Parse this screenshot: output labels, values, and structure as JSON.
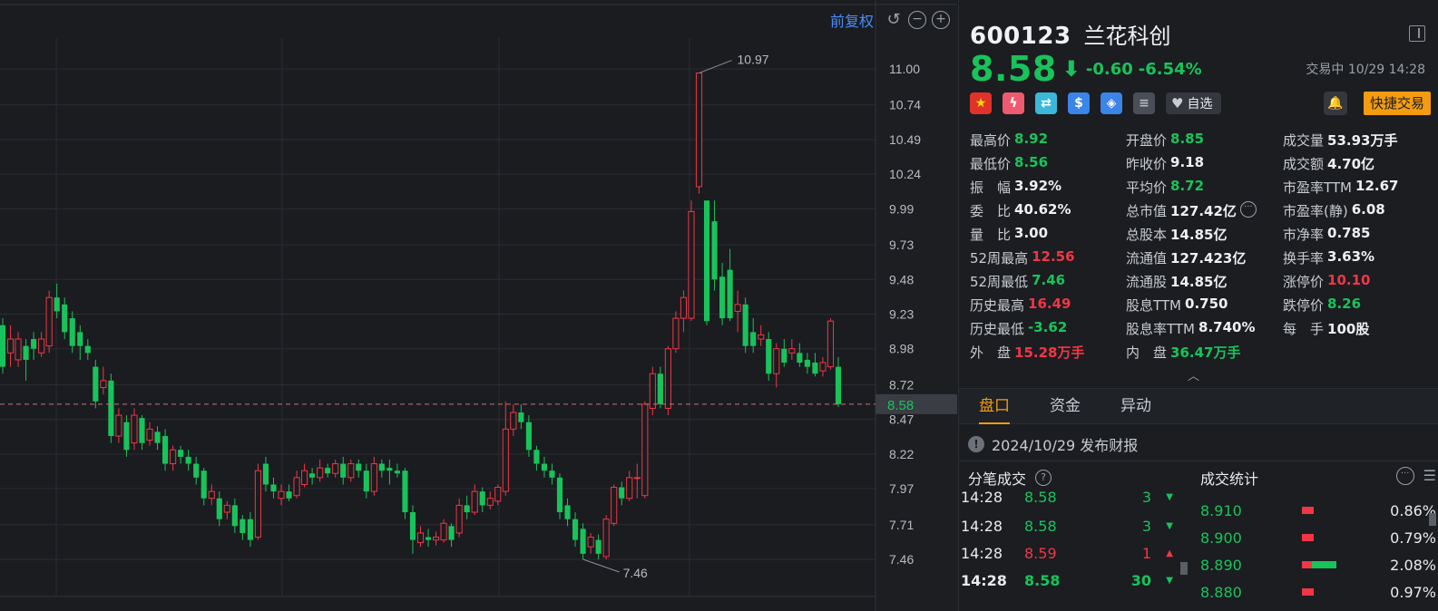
{
  "toolbar": {
    "restore_label": "前复权"
  },
  "chart_data": {
    "type": "candlestick",
    "y_ticks": [
      "11.00",
      "10.74",
      "10.49",
      "10.24",
      "9.99",
      "9.73",
      "9.48",
      "9.23",
      "8.98",
      "8.72",
      "8.47",
      "8.22",
      "7.97",
      "7.71",
      "7.46"
    ],
    "ylim": [
      7.35,
      11.12
    ],
    "current_price_label": "8.58",
    "current_price": 8.58,
    "high_annotation": "10.97",
    "low_annotation": "7.46",
    "colors": {
      "up": "#f23645",
      "down": "#19c35b",
      "grid": "#2a2d33"
    },
    "candles": [
      [
        9.15,
        8.85,
        9.2,
        8.8
      ],
      [
        8.95,
        9.05,
        9.15,
        8.85
      ],
      [
        8.9,
        9.05,
        9.1,
        8.85
      ],
      [
        9.0,
        8.9,
        9.05,
        8.75
      ],
      [
        9.05,
        8.98,
        9.1,
        8.9
      ],
      [
        8.95,
        9.05,
        9.1,
        8.92
      ],
      [
        9.0,
        9.35,
        9.4,
        8.95
      ],
      [
        9.35,
        9.25,
        9.45,
        9.2
      ],
      [
        9.3,
        9.1,
        9.35,
        9.05
      ],
      [
        9.2,
        9.0,
        9.25,
        8.95
      ],
      [
        9.1,
        9.0,
        9.15,
        8.9
      ],
      [
        9.0,
        8.95,
        9.05,
        8.9
      ],
      [
        8.85,
        8.6,
        8.9,
        8.55
      ],
      [
        8.7,
        8.75,
        8.85,
        8.65
      ],
      [
        8.75,
        8.35,
        8.8,
        8.3
      ],
      [
        8.35,
        8.5,
        8.55,
        8.3
      ],
      [
        8.45,
        8.25,
        8.5,
        8.2
      ],
      [
        8.3,
        8.5,
        8.55,
        8.25
      ],
      [
        8.48,
        8.3,
        8.5,
        8.25
      ],
      [
        8.32,
        8.4,
        8.45,
        8.28
      ],
      [
        8.38,
        8.3,
        8.42,
        8.25
      ],
      [
        8.35,
        8.15,
        8.4,
        8.1
      ],
      [
        8.15,
        8.25,
        8.28,
        8.1
      ],
      [
        8.25,
        8.2,
        8.28,
        8.15
      ],
      [
        8.2,
        8.15,
        8.25,
        8.1
      ],
      [
        8.15,
        8.05,
        8.2,
        8.0
      ],
      [
        8.1,
        7.9,
        8.12,
        7.85
      ],
      [
        7.9,
        7.95,
        8.0,
        7.85
      ],
      [
        7.9,
        7.75,
        7.95,
        7.7
      ],
      [
        7.8,
        7.85,
        7.88,
        7.75
      ],
      [
        7.85,
        7.7,
        7.9,
        7.65
      ],
      [
        7.75,
        7.65,
        7.78,
        7.6
      ],
      [
        7.75,
        7.6,
        7.8,
        7.55
      ],
      [
        7.62,
        8.1,
        8.15,
        7.6
      ],
      [
        8.15,
        8.0,
        8.2,
        7.95
      ],
      [
        8.0,
        7.95,
        8.05,
        7.9
      ],
      [
        7.9,
        7.95,
        8.0,
        7.85
      ],
      [
        7.95,
        7.9,
        8.0,
        7.88
      ],
      [
        7.92,
        8.05,
        8.1,
        7.9
      ],
      [
        8.0,
        8.1,
        8.15,
        7.98
      ],
      [
        8.08,
        8.05,
        8.12,
        8.0
      ],
      [
        8.05,
        8.12,
        8.18,
        8.02
      ],
      [
        8.12,
        8.08,
        8.15,
        8.05
      ],
      [
        8.08,
        8.15,
        8.18,
        8.05
      ],
      [
        8.15,
        8.05,
        8.2,
        8.0
      ],
      [
        8.05,
        8.15,
        8.18,
        8.02
      ],
      [
        8.15,
        8.1,
        8.18,
        8.05
      ],
      [
        8.1,
        7.95,
        8.15,
        7.9
      ],
      [
        7.95,
        8.15,
        8.2,
        7.92
      ],
      [
        8.15,
        8.1,
        8.18,
        8.05
      ],
      [
        8.12,
        8.1,
        8.18,
        8.0
      ],
      [
        8.1,
        8.08,
        8.15,
        8.05
      ],
      [
        8.1,
        7.8,
        8.12,
        7.75
      ],
      [
        7.8,
        7.6,
        7.85,
        7.5
      ],
      [
        7.58,
        7.65,
        7.7,
        7.55
      ],
      [
        7.62,
        7.6,
        7.68,
        7.55
      ],
      [
        7.6,
        7.62,
        7.66,
        7.56
      ],
      [
        7.6,
        7.72,
        7.75,
        7.58
      ],
      [
        7.7,
        7.6,
        7.72,
        7.55
      ],
      [
        7.65,
        7.85,
        7.9,
        7.62
      ],
      [
        7.85,
        7.8,
        7.92,
        7.75
      ],
      [
        7.8,
        7.95,
        8.0,
        7.78
      ],
      [
        7.95,
        7.85,
        7.98,
        7.8
      ],
      [
        7.85,
        7.9,
        7.95,
        7.82
      ],
      [
        7.88,
        7.98,
        8.0,
        7.85
      ],
      [
        7.95,
        8.4,
        8.6,
        7.92
      ],
      [
        8.4,
        8.52,
        8.58,
        8.35
      ],
      [
        8.52,
        8.45,
        8.58,
        8.4
      ],
      [
        8.45,
        8.25,
        8.5,
        8.2
      ],
      [
        8.25,
        8.15,
        8.28,
        8.1
      ],
      [
        8.15,
        8.1,
        8.2,
        8.05
      ],
      [
        8.1,
        8.05,
        8.15,
        8.0
      ],
      [
        8.05,
        7.8,
        8.08,
        7.75
      ],
      [
        7.85,
        7.75,
        7.9,
        7.7
      ],
      [
        7.75,
        7.6,
        7.8,
        7.55
      ],
      [
        7.68,
        7.5,
        7.72,
        7.46
      ],
      [
        7.55,
        7.62,
        7.65,
        7.5
      ],
      [
        7.6,
        7.5,
        7.64,
        7.46
      ],
      [
        7.48,
        7.75,
        7.78,
        7.46
      ],
      [
        7.72,
        7.98,
        8.0,
        7.7
      ],
      [
        7.98,
        7.9,
        8.02,
        7.85
      ],
      [
        7.9,
        8.05,
        8.1,
        7.88
      ],
      [
        8.05,
        8.05,
        8.15,
        7.9
      ],
      [
        7.92,
        8.58,
        8.6,
        7.9
      ],
      [
        8.55,
        8.8,
        8.85,
        8.5
      ],
      [
        8.8,
        8.58,
        8.85,
        8.55
      ],
      [
        8.55,
        8.98,
        9.0,
        8.5
      ],
      [
        8.98,
        9.2,
        9.25,
        8.95
      ],
      [
        9.2,
        9.35,
        9.4,
        9.1
      ],
      [
        9.2,
        9.97,
        10.05,
        9.18
      ],
      [
        10.15,
        10.97,
        10.97,
        10.1
      ],
      [
        10.05,
        9.18,
        10.05,
        9.15
      ],
      [
        9.9,
        9.48,
        10.05,
        9.4
      ],
      [
        9.5,
        9.2,
        9.6,
        9.15
      ],
      [
        9.55,
        9.2,
        9.7,
        9.18
      ],
      [
        9.25,
        9.3,
        9.4,
        9.1
      ],
      [
        9.3,
        9.0,
        9.35,
        8.95
      ],
      [
        9.1,
        9.0,
        9.2,
        8.95
      ],
      [
        9.05,
        9.08,
        9.15,
        9.0
      ],
      [
        9.05,
        8.8,
        9.1,
        8.75
      ],
      [
        8.8,
        8.98,
        9.02,
        8.7
      ],
      [
        8.98,
        8.88,
        9.05,
        8.85
      ],
      [
        8.95,
        8.98,
        9.05,
        8.9
      ],
      [
        8.95,
        8.88,
        9.02,
        8.85
      ],
      [
        8.9,
        8.85,
        8.95,
        8.8
      ],
      [
        8.88,
        8.8,
        8.95,
        8.78
      ],
      [
        8.82,
        8.88,
        8.92,
        8.78
      ],
      [
        8.85,
        9.18,
        9.2,
        8.83
      ],
      [
        8.85,
        8.58,
        8.92,
        8.56
      ]
    ]
  },
  "quote": {
    "code": "600123",
    "name": "兰花科创",
    "price": "8.58",
    "arrow": "⬇",
    "change": "-0.60",
    "change_pct": "-6.54%",
    "status": "交易中 10/29 14:28",
    "icons": [
      "china-flag-icon",
      "flash-icon",
      "swap-icon",
      "dollar-icon",
      "tag-icon",
      "notes-icon"
    ],
    "watch_label": "自选",
    "quick_trade_label": "快捷交易"
  },
  "stats": {
    "col1": [
      {
        "label": "最高价",
        "value": "8.92",
        "color": "g"
      },
      {
        "label": "最低价",
        "value": "8.56",
        "color": "g"
      },
      {
        "label": "振　幅",
        "value": "3.92%",
        "color": "w"
      },
      {
        "label": "委　比",
        "value": "40.62%",
        "color": "w"
      },
      {
        "label": "量　比",
        "value": "3.00",
        "color": "w"
      },
      {
        "label": "52周最高",
        "value": "12.56",
        "color": "r"
      },
      {
        "label": "52周最低",
        "value": "7.46",
        "color": "g"
      },
      {
        "label": "历史最高",
        "value": "16.49",
        "color": "r"
      },
      {
        "label": "历史最低",
        "value": "-3.62",
        "color": "g"
      },
      {
        "label": "外　盘",
        "value": "15.28万手",
        "color": "r"
      }
    ],
    "col2": [
      {
        "label": "开盘价",
        "value": "8.85",
        "color": "g"
      },
      {
        "label": "昨收价",
        "value": "9.18",
        "color": "w"
      },
      {
        "label": "平均价",
        "value": "8.72",
        "color": "g"
      },
      {
        "label": "总市值",
        "value": "127.42亿",
        "color": "w"
      },
      {
        "label": "总股本",
        "value": "14.85亿",
        "color": "w"
      },
      {
        "label": "流通值",
        "value": "127.423亿",
        "color": "w"
      },
      {
        "label": "流通股",
        "value": "14.85亿",
        "color": "w"
      },
      {
        "label": "股息TTM",
        "value": "0.750",
        "color": "w"
      },
      {
        "label": "股息率TTM",
        "value": "8.740%",
        "color": "w"
      },
      {
        "label": "内　盘",
        "value": "36.47万手",
        "color": "g"
      }
    ],
    "col3": [
      {
        "label": "成交量",
        "value": "53.93万手",
        "color": "w"
      },
      {
        "label": "成交额",
        "value": "4.70亿",
        "color": "w"
      },
      {
        "label": "市盈率TTM",
        "value": "12.67",
        "color": "w"
      },
      {
        "label": "市盈率(静)",
        "value": "6.08",
        "color": "w"
      },
      {
        "label": "市净率",
        "value": "0.785",
        "color": "w"
      },
      {
        "label": "换手率",
        "value": "3.63%",
        "color": "w"
      },
      {
        "label": "涨停价",
        "value": "10.10",
        "color": "r"
      },
      {
        "label": "跌停价",
        "value": "8.26",
        "color": "g"
      },
      {
        "label": "每　手",
        "value": "100股",
        "color": "w"
      }
    ]
  },
  "tabs": [
    "盘口",
    "资金",
    "异动"
  ],
  "notice": "2024/10/29  发布财报",
  "ticks_title": "分笔成交",
  "stat_title": "成交统计",
  "ticks": [
    {
      "time": "14:28",
      "price": "8.58",
      "vol": "3",
      "side": "down",
      "bold": false
    },
    {
      "time": "14:28",
      "price": "8.58",
      "vol": "3",
      "side": "down",
      "bold": false
    },
    {
      "time": "14:28",
      "price": "8.59",
      "vol": "1",
      "side": "up",
      "bold": false
    },
    {
      "time": "14:28",
      "price": "8.58",
      "vol": "30",
      "side": "down",
      "bold": true
    }
  ],
  "volume_stats": [
    {
      "price": "8.910",
      "pct": "0.86%",
      "red": 0.22,
      "green": 0
    },
    {
      "price": "8.900",
      "pct": "0.79%",
      "red": 0.22,
      "green": 0
    },
    {
      "price": "8.890",
      "pct": "2.08%",
      "red": 0.18,
      "green": 0.45
    },
    {
      "price": "8.880",
      "pct": "0.97%",
      "red": 0.22,
      "green": 0
    }
  ]
}
